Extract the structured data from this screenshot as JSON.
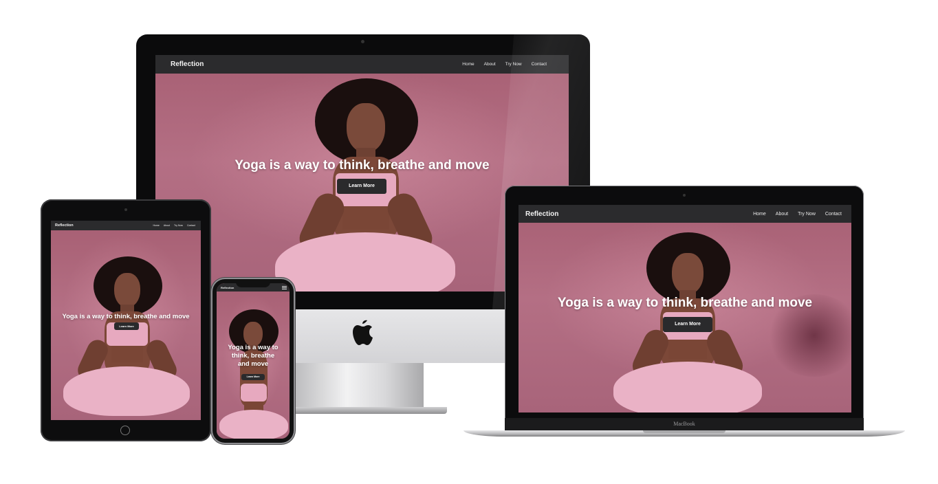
{
  "site": {
    "brand": "Reflection",
    "nav": [
      "Home",
      "About",
      "Try Now",
      "Contact"
    ],
    "hero_title": "Yoga is a way to think, breathe and move",
    "hero_title_lines": [
      "Yoga is a way to",
      "think, breathe",
      "and move"
    ],
    "cta_label": "Learn More"
  },
  "laptop": {
    "label": "MacBook"
  },
  "colors": {
    "navbar": "#2b2b2d",
    "hero": "#b56f83",
    "button": "#2a2a2c"
  },
  "icons": [
    "apple-logo-icon",
    "hamburger-menu-icon"
  ]
}
